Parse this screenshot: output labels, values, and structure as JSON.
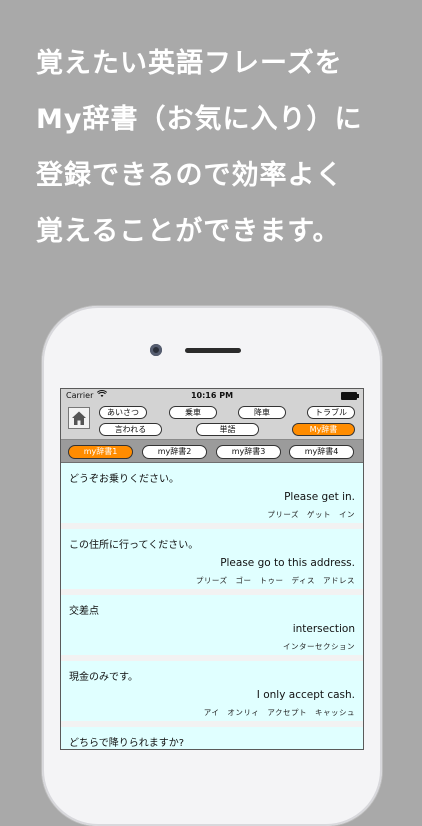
{
  "headline": {
    "line1": "覚えたい英語フレーズを",
    "line2": "My辞書（お気に入り）に",
    "line3": "登録できるので効率よく",
    "line4": "覚えることができます。"
  },
  "status_bar": {
    "carrier": "Carrier",
    "time": "10:16 PM",
    "wifi_icon": "wifi-icon",
    "battery_icon": "battery-icon"
  },
  "categories": {
    "row1": [
      "あいさつ",
      "乗車",
      "降車",
      "トラブル"
    ],
    "row2": [
      "言われる",
      "単語",
      "My辞書"
    ],
    "active": "My辞書"
  },
  "tabs": {
    "items": [
      "my辞書1",
      "my辞書2",
      "my辞書3",
      "my辞書4"
    ],
    "active_index": 0
  },
  "phrases": [
    {
      "jp": "どうぞお乗りください。",
      "en": "Please get in.",
      "kana": "プリーズ　ゲット　イン"
    },
    {
      "jp": "この住所に行ってください。",
      "en": "Please go to this address.",
      "kana": "プリーズ　ゴー　トゥー　ディス　アドレス"
    },
    {
      "jp": "交差点",
      "en": "intersection",
      "kana": "インターセクション"
    },
    {
      "jp": "現金のみです。",
      "en": "I only accept cash.",
      "kana": "アイ　オンリィ　アクセプト　キャッシュ"
    },
    {
      "jp": "どちらで降りられますか?",
      "en": "",
      "kana": ""
    }
  ],
  "colors": {
    "background": "#a9a9a9",
    "accent_orange": "#ff8c00",
    "item_bg": "#e0ffff"
  }
}
